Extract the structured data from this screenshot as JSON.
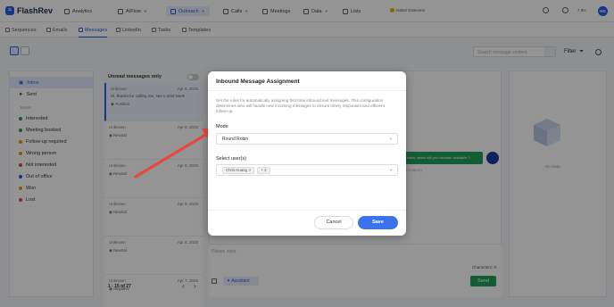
{
  "app": {
    "name": "FlashRev"
  },
  "topnav": {
    "items": [
      "Analytics",
      "AIFlow",
      "Outreach",
      "Calls",
      "Meetings",
      "Data",
      "Lists"
    ],
    "user": "Isabel Estevane",
    "minutes": "7.9H",
    "avatar": "HG"
  },
  "subnav": [
    "Sequences",
    "Emails",
    "Messages",
    "LinkedIn",
    "Tasks",
    "Templates"
  ],
  "toolbar": {
    "search_placeholder": "Search message content",
    "filter": "Filter"
  },
  "left": {
    "inbox": "Inbox",
    "sent": "Sent",
    "section_label": "Event",
    "events": [
      {
        "label": "Interested",
        "color": "#2b9a5a"
      },
      {
        "label": "Meeting booked",
        "color": "#2b9a5a"
      },
      {
        "label": "Follow-up required",
        "color": "#e0a000"
      },
      {
        "label": "Wrong person",
        "color": "#e0a000"
      },
      {
        "label": "Not interested",
        "color": "#e04848"
      },
      {
        "label": "Out of office",
        "color": "#2b5ce6"
      },
      {
        "label": "Won",
        "color": "#e0a000"
      },
      {
        "label": "Lost",
        "color": "#e04848"
      }
    ]
  },
  "list": {
    "header": "Unread messages only",
    "messages": [
      {
        "name": "Unknown",
        "date": "Apr 8, 2025",
        "text": "Hi, thanks for calling me, see u next week",
        "tag": "Positive"
      },
      {
        "name": "Unknown",
        "date": "Apr 8, 2025",
        "text": "",
        "tag": "Neutral"
      },
      {
        "name": "Unknown",
        "date": "Apr 8, 2025",
        "text": "",
        "tag": "Neutral"
      },
      {
        "name": "Unknown",
        "date": "Apr 8, 2025",
        "text": "",
        "tag": "Neutral"
      },
      {
        "name": "Unknown",
        "date": "Apr 8, 2025",
        "text": "",
        "tag": "Neutral"
      },
      {
        "name": "Unknown",
        "date": "Apr 7, 2025",
        "text": "",
        "tag": "Negative"
      }
    ],
    "pager": "1 - 15 of 27"
  },
  "chat": {
    "bubble": "Hello, when will you become available ?",
    "bubble_meta": "TKA-7429 · 14:37, Apr 8, 2025 (UTC+08:00)",
    "reply_placeholder": "Please input",
    "characters": "Characters: 0",
    "assistant": "Assistant",
    "send": "Send"
  },
  "right": {
    "empty": "No Data"
  },
  "modal": {
    "title": "Inbound Message Assignment",
    "description": "Set the rules for automatically assigning first-time inbound text messages. This configuration determines who will handle new incoming messages to ensure timely responses and efficient follow-up.",
    "mode_label": "Mode",
    "mode_value": "Round Robin",
    "users_label": "Select user(s)",
    "users": [
      "Chris Huang"
    ],
    "users_more": "+ 3",
    "cancel": "Cancel",
    "save": "Save"
  }
}
